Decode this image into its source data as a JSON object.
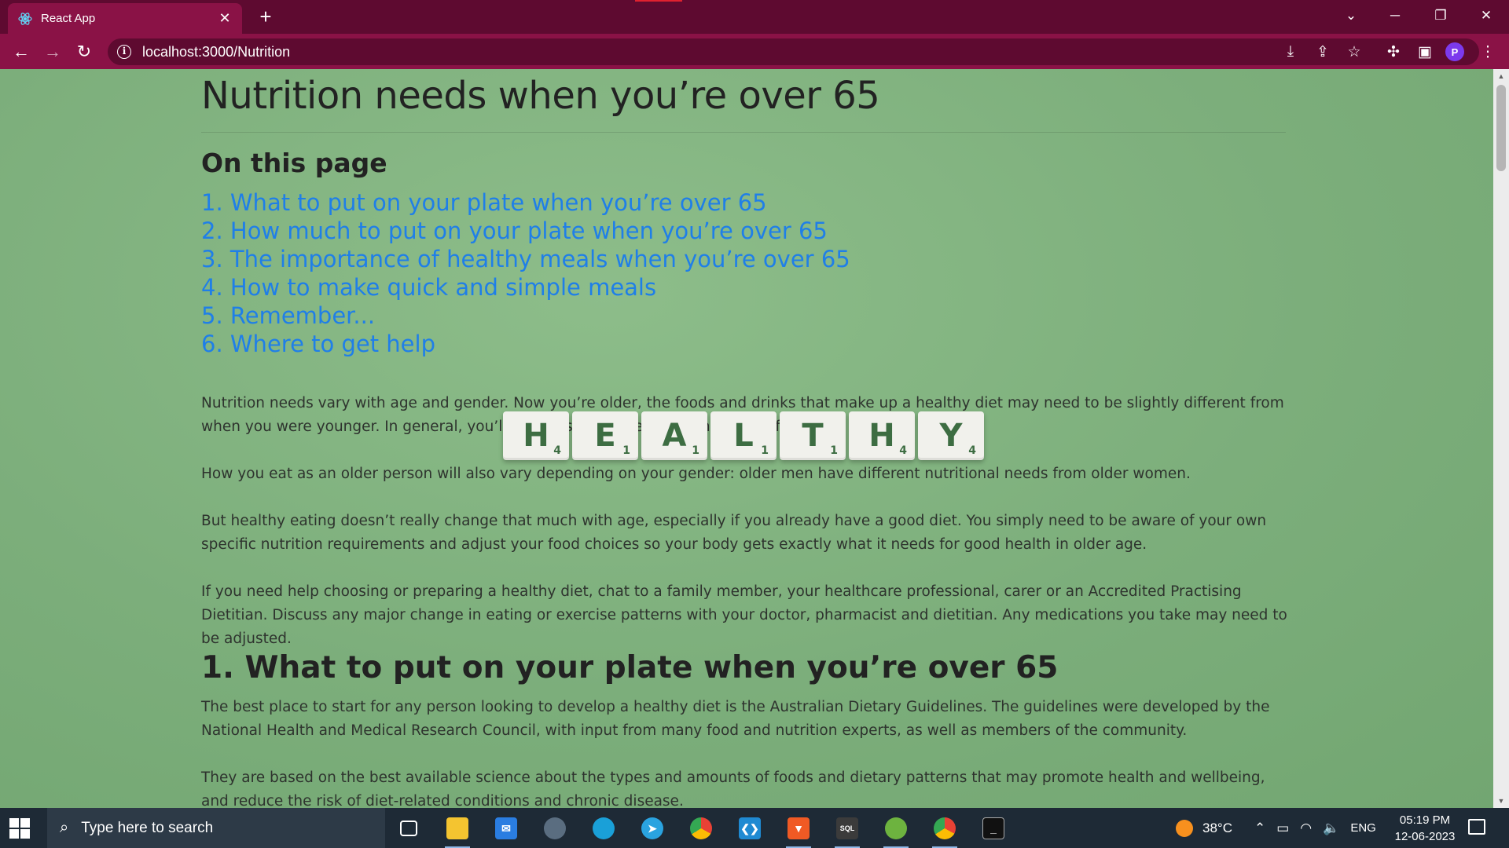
{
  "browser": {
    "tab_title": "React App",
    "url": "localhost:3000/Nutrition",
    "profile_initial": "P"
  },
  "page": {
    "title": "Nutrition needs when you’re over 65",
    "toc_heading": "On this page",
    "toc": [
      "1. What to put on your plate when you’re over 65",
      "2. How much to put on your plate when you’re over 65",
      "3. The importance of healthy meals when you’re over 65",
      "4. How to make quick and simple meals",
      "5. Remember...",
      "6. Where to get help"
    ],
    "paragraphs": [
      "Nutrition needs vary with age and gender. Now you’re older, the foods and drinks that make up a healthy diet may need to be slightly different from when you were younger. In general, you’ll need less of some foods and more of others.",
      "How you eat as an older person will also vary depending on your gender: older men have different nutritional needs from older women.",
      "But healthy eating doesn’t really change that much with age, especially if you already have a good diet. You simply need to be aware of your own specific nutrition requirements and adjust your food choices so your body gets exactly what it needs for good health in older age.",
      "If you need help choosing or preparing a healthy diet, chat to a family member, your healthcare professional, carer or an Accredited Practising Dietitian. Discuss any major change in eating or exercise patterns with your doctor, pharmacist and dietitian. Any medications you take may need to be adjusted."
    ],
    "section1_heading": "1. What to put on your plate when you’re over 65",
    "section1_paragraphs": [
      "The best place to start for any person looking to develop a healthy diet is the Australian Dietary Guidelines. The guidelines were developed by the National Health and Medical Research Council, with input from many food and nutrition experts, as well as members of the community.",
      "They are based on the best available science about the types and amounts of foods and dietary patterns that may promote health and wellbeing, and reduce the risk of diet-related conditions and chronic disease."
    ],
    "tiles": [
      {
        "letter": "H",
        "points": "4"
      },
      {
        "letter": "E",
        "points": "1"
      },
      {
        "letter": "A",
        "points": "1"
      },
      {
        "letter": "L",
        "points": "1"
      },
      {
        "letter": "T",
        "points": "1"
      },
      {
        "letter": "H",
        "points": "4"
      },
      {
        "letter": "Y",
        "points": "4"
      }
    ]
  },
  "taskbar": {
    "search_placeholder": "Type here to search",
    "weather": "38°C",
    "language": "ENG",
    "time": "05:19 PM",
    "date": "12-06-2023"
  },
  "colors": {
    "tab_bar": "#5e0a30",
    "toolbar": "#8a1246",
    "link": "#1f7fe8",
    "page_bg": "#7fb07e"
  }
}
